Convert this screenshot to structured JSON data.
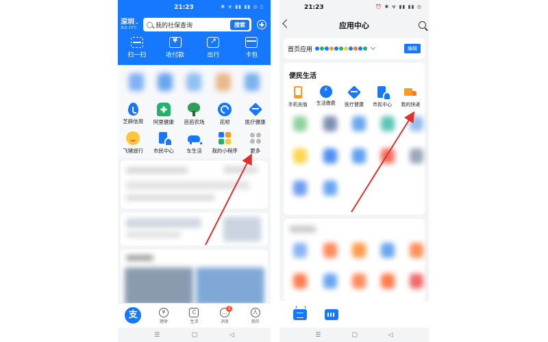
{
  "left": {
    "status": {
      "time": "21:23",
      "icons": "✱ ᯤ ▮▮ ▮▮ ◎ ▯"
    },
    "location": {
      "city": "深圳",
      "weather": "多云 23℃"
    },
    "search": {
      "placeholder": "我的社保查询",
      "button": "搜索"
    },
    "quick_actions": [
      {
        "label": "扫一扫",
        "icon": "scan-icon"
      },
      {
        "label": "收付款",
        "icon": "payment-icon"
      },
      {
        "label": "出行",
        "icon": "travel-icon"
      },
      {
        "label": "卡包",
        "icon": "card-wallet-icon"
      }
    ],
    "apps_row1": [
      {
        "label": "芝麻信用",
        "icon": "sesame-credit-icon"
      },
      {
        "label": "阿里健康",
        "icon": "ali-health-icon"
      },
      {
        "label": "芭芭农场",
        "icon": "farm-tree-icon"
      },
      {
        "label": "花呗",
        "icon": "huabei-icon"
      },
      {
        "label": "医疗健康",
        "icon": "medical-health-icon"
      }
    ],
    "apps_row2": [
      {
        "label": "飞猪旅行",
        "icon": "fliggy-icon"
      },
      {
        "label": "市民中心",
        "icon": "citizen-center-icon"
      },
      {
        "label": "车生活",
        "icon": "car-life-icon"
      },
      {
        "label": "我的小程序",
        "icon": "mini-programs-icon"
      },
      {
        "label": "更多",
        "icon": "more-icon"
      }
    ],
    "tabbar": [
      {
        "label": "",
        "glyph": "支",
        "icon": "alipay-home-icon"
      },
      {
        "label": "理财",
        "glyph": "¥",
        "icon": "wealth-icon"
      },
      {
        "label": "生活",
        "glyph": "C",
        "icon": "life-icon"
      },
      {
        "label": "消息",
        "glyph": "…",
        "icon": "message-icon",
        "badge": "6"
      },
      {
        "label": "我的",
        "glyph": "人",
        "icon": "profile-icon"
      }
    ],
    "nav": {
      "menu": "☰",
      "home": "▢",
      "back": "◁"
    }
  },
  "right": {
    "status": {
      "time": "21:23",
      "icons": "⏰ ✱ ᯤ ▮▮ ▮▮ ◎"
    },
    "header": {
      "title": "应用中心"
    },
    "home_apps": {
      "label": "首页应用",
      "edit": "编辑"
    },
    "section": {
      "title": "便民生活",
      "apps": [
        {
          "label": "手机充值",
          "icon": "phone-recharge-icon"
        },
        {
          "label": "生活缴费",
          "icon": "utility-payment-icon"
        },
        {
          "label": "医疗健康",
          "icon": "medical-health-icon"
        },
        {
          "label": "市民中心",
          "icon": "citizen-center-icon"
        },
        {
          "label": "我的快递",
          "icon": "delivery-truck-icon"
        }
      ]
    },
    "nav": {
      "menu": "☰",
      "home": "▢",
      "back": "◁"
    }
  },
  "colors": {
    "primary": "#1677ff",
    "annotation_arrow": "#e0302c",
    "orange": "#ff9a1f",
    "green": "#23b26d"
  }
}
